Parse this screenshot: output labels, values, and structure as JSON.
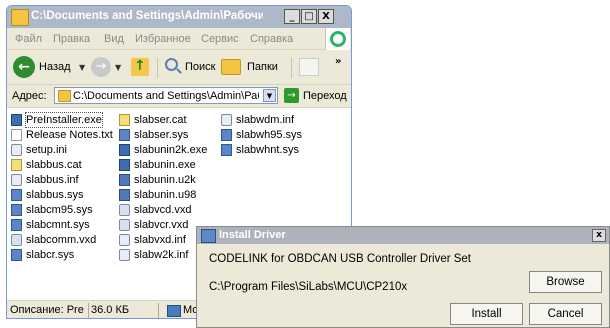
{
  "explorer": {
    "title": "C:\\Documents and Settings\\Admin\\Рабочий стол\\c...",
    "window_buttons": {
      "minimize": "_",
      "maximize": "□",
      "close": "X"
    },
    "menu": [
      "Файл",
      "Правка",
      "Вид",
      "Избранное",
      "Сервис",
      "Справка"
    ],
    "toolbar": {
      "back_label": "Назад",
      "search_label": "Поиск",
      "folders_label": "Папки",
      "overflow": "»"
    },
    "address": {
      "label": "Адрес:",
      "value": "C:\\Documents and Settings\\Admin\\Рабочий",
      "go_label": "Переход"
    },
    "files": [
      {
        "name": "PreInstaller.exe",
        "icon": "exe-icon"
      },
      {
        "name": "Release Notes.txt",
        "icon": "text-file-icon"
      },
      {
        "name": "setup.ini",
        "icon": "ini-file-icon"
      },
      {
        "name": "slabbus.cat",
        "icon": "catalog-file-icon"
      },
      {
        "name": "slabbus.inf",
        "icon": "inf-file-icon"
      },
      {
        "name": "slabbus.sys",
        "icon": "sys-file-icon"
      },
      {
        "name": "slabcm95.sys",
        "icon": "sys-file-icon"
      },
      {
        "name": "slabcmnt.sys",
        "icon": "sys-file-icon"
      },
      {
        "name": "slabcomm.vxd",
        "icon": "vxd-file-icon"
      },
      {
        "name": "slabcr.sys",
        "icon": "sys-file-icon"
      },
      {
        "name": "slabser.cat",
        "icon": "catalog-file-icon"
      },
      {
        "name": "slabser.sys",
        "icon": "sys-file-icon"
      },
      {
        "name": "slabunin2k.exe",
        "icon": "exe-icon"
      },
      {
        "name": "slabunin.exe",
        "icon": "exe-icon"
      },
      {
        "name": "slabunin.u2k",
        "icon": "u2k-file-icon"
      },
      {
        "name": "slabunin.u98",
        "icon": "u2k-file-icon"
      },
      {
        "name": "slabvcd.vxd",
        "icon": "vxd-file-icon"
      },
      {
        "name": "slabvcr.vxd",
        "icon": "vxd-file-icon"
      },
      {
        "name": "slabvxd.inf",
        "icon": "inf-file-icon"
      },
      {
        "name": "slabw2k.inf",
        "icon": "inf-file-icon"
      },
      {
        "name": "slabwdm.inf",
        "icon": "inf-file-icon"
      },
      {
        "name": "slabwh95.sys",
        "icon": "sys-file-icon"
      },
      {
        "name": "slabwhnt.sys",
        "icon": "sys-file-icon"
      }
    ],
    "status": {
      "description": "Описание: PreIns",
      "size": "36.0 КБ",
      "location": "Мой"
    }
  },
  "dialog": {
    "title": "Install Driver",
    "close_glyph": "x",
    "heading": "CODELINK for OBDCAN USB Controller Driver Set",
    "path": "C:\\Program Files\\SiLabs\\MCU\\CP210x",
    "browse_label": "Browse",
    "install_label": "Install",
    "cancel_label": "Cancel"
  },
  "colors": {
    "window_face": "#ece9d8",
    "titlebar_inactive": "#adb8c8",
    "go_green": "#2e9a2e"
  }
}
